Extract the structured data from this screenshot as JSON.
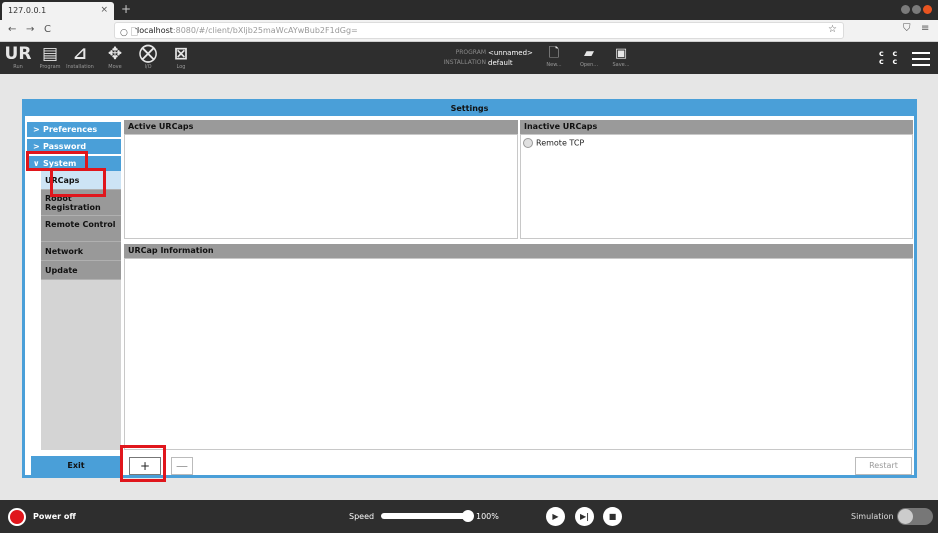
{
  "browser": {
    "tab_title": "127.0.0.1",
    "tab_close": "×",
    "new_tab": "+",
    "back": "←",
    "forward": "→",
    "reload": "C",
    "url_host": "localhost",
    "url_rest": ":8080/#/client/bXljb25maWcAYwBub2F1dGg=",
    "star": "☆"
  },
  "header": {
    "nav": [
      {
        "label": "Run",
        "glyph": "UR",
        "icon": "run-icon"
      },
      {
        "label": "Program",
        "glyph": "▤",
        "icon": "program-icon"
      },
      {
        "label": "Installation",
        "glyph": "⊿",
        "icon": "installation-icon"
      },
      {
        "label": "Move",
        "glyph": "✥",
        "icon": "move-icon"
      },
      {
        "label": "I/O",
        "glyph": "⛒",
        "icon": "io-icon"
      },
      {
        "label": "Log",
        "glyph": "⊠",
        "icon": "log-icon"
      }
    ],
    "program_label": "PROGRAM",
    "installation_label": "INSTALLATION",
    "program_value": "<unnamed>",
    "installation_value": "default",
    "file_buttons": [
      {
        "label": "New...",
        "glyph": "🗋",
        "icon": "new-file-icon"
      },
      {
        "label": "Open...",
        "glyph": "▰",
        "icon": "open-folder-icon"
      },
      {
        "label": "Save...",
        "glyph": "▣",
        "icon": "save-icon"
      }
    ],
    "cc_top": "c c",
    "cc_bottom": "c c"
  },
  "settings": {
    "title": "Settings",
    "sidebar": {
      "preferences": "Preferences",
      "password": "Password",
      "system": "System",
      "sub_items": [
        "URCaps",
        "Robot Registration",
        "Remote Control",
        "Network",
        "Update"
      ]
    },
    "active_header": "Active URCaps",
    "inactive_header": "Inactive URCaps",
    "inactive_items": [
      "Remote TCP"
    ],
    "info_header": "URCap Information",
    "exit_label": "Exit",
    "add_label": "+",
    "remove_label": "—",
    "restart_label": "Restart"
  },
  "footer": {
    "power_label": "Power off",
    "speed_label": "Speed",
    "speed_value": "100%",
    "speed_fraction": 1.0,
    "simulation_label": "Simulation"
  },
  "colors": {
    "accent": "#4a9fd8",
    "highlight": "#e0161c",
    "dark_bar": "#2e2e2e"
  }
}
